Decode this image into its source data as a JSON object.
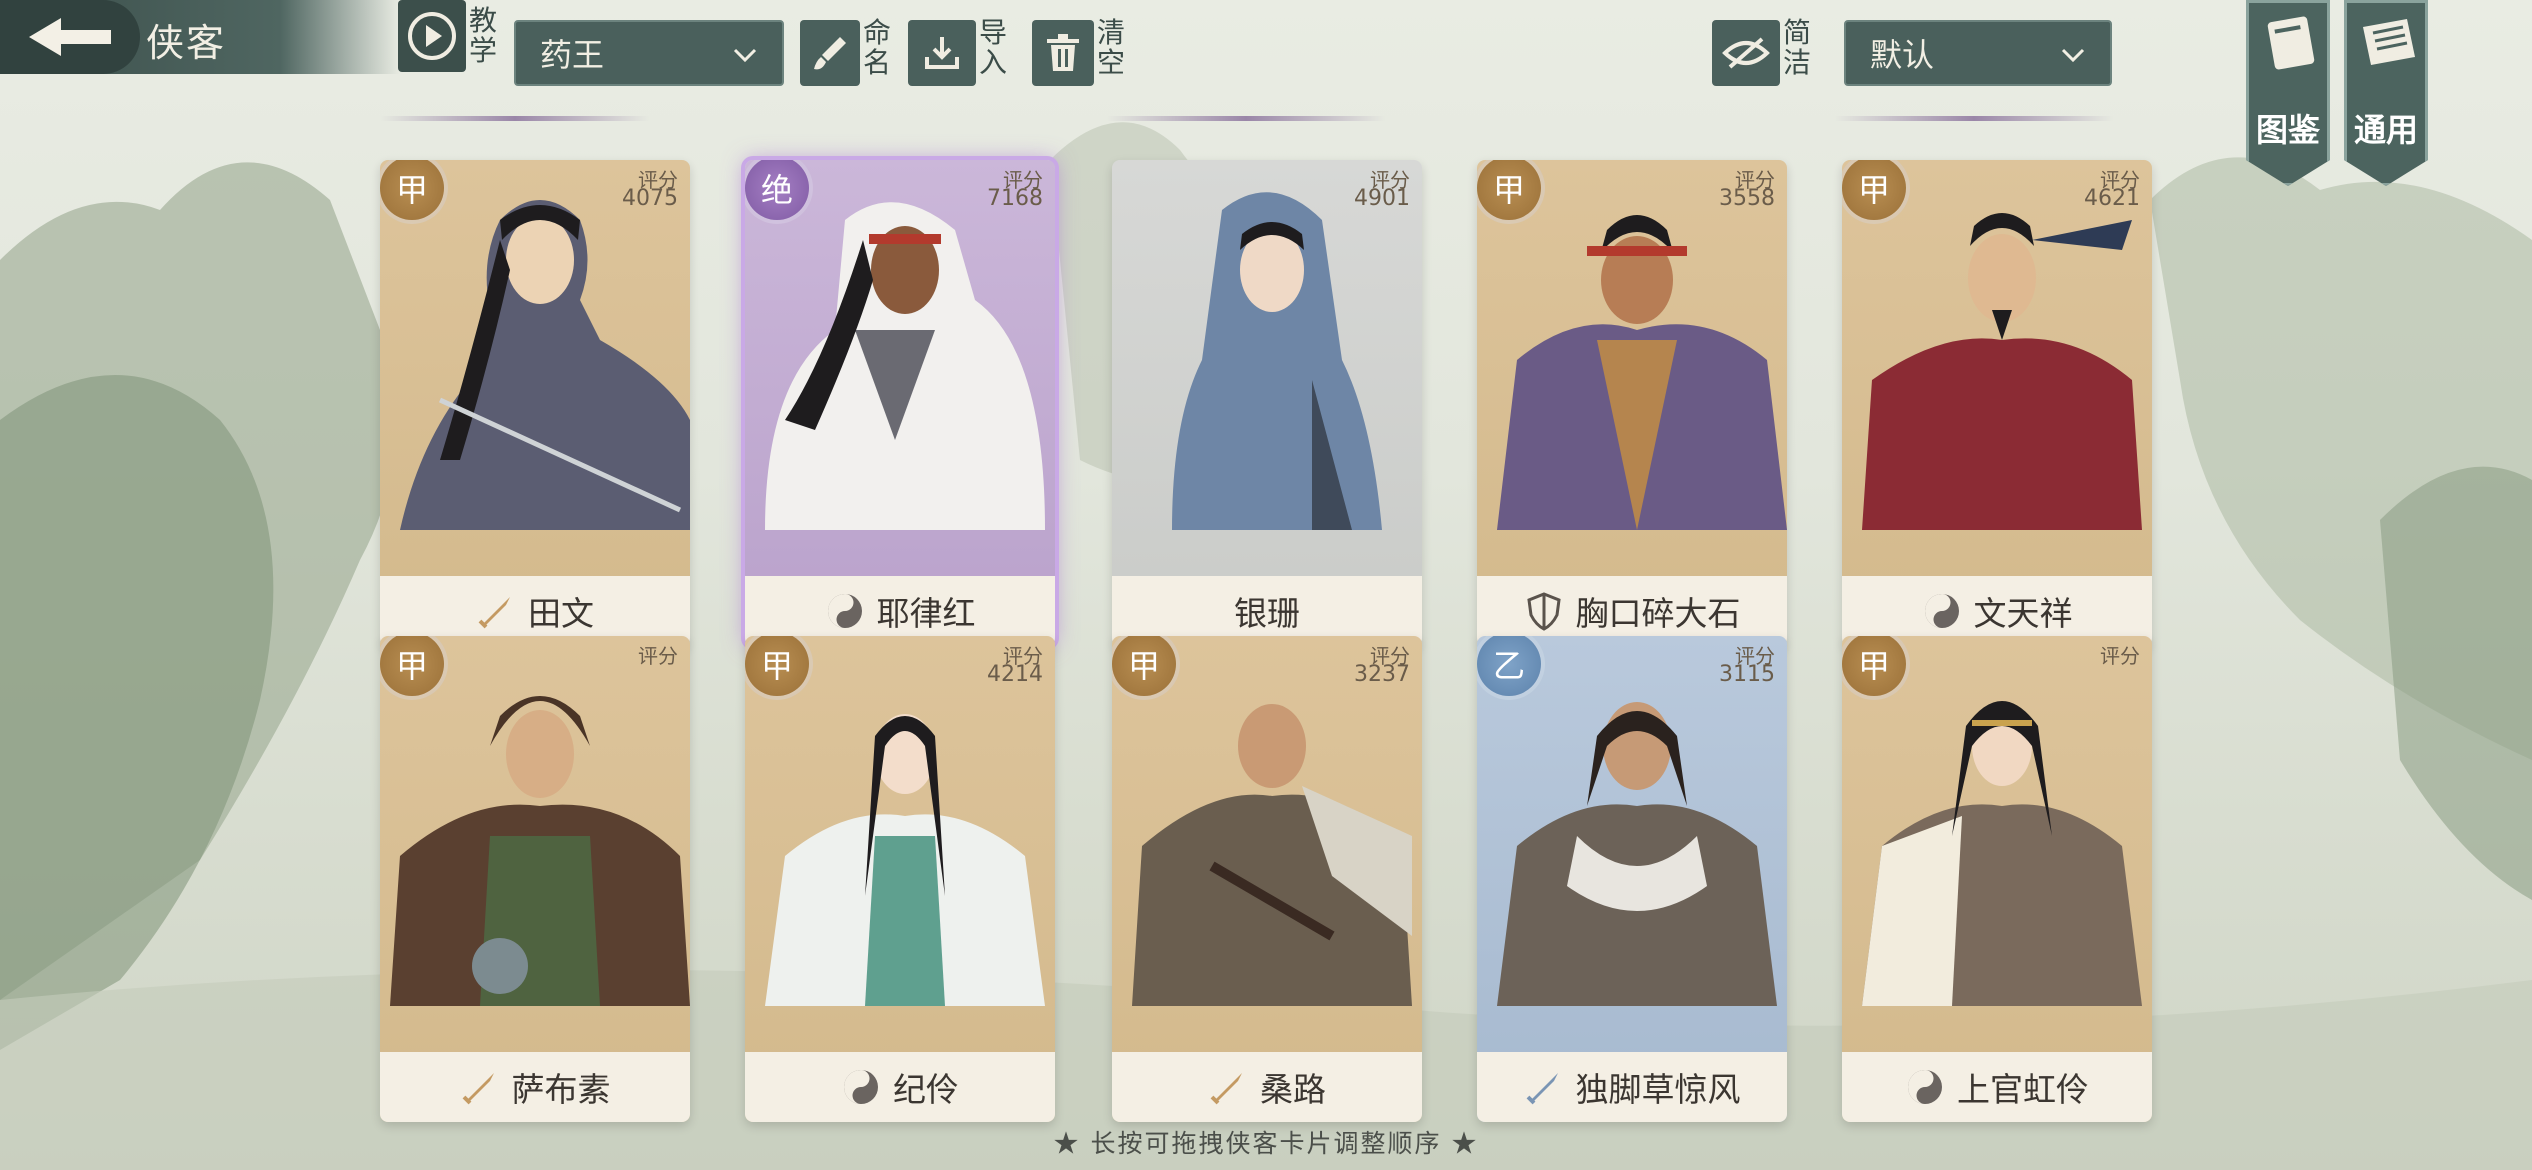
{
  "header": {
    "title": "侠客",
    "tutorial_label": "教学",
    "preset_select": "药王",
    "rename_label": "命名",
    "import_label": "导入",
    "clear_label": "清空",
    "simple_label": "简洁",
    "sort_select": "默认",
    "codex_label": "图鉴",
    "general_label": "通用"
  },
  "cards": [
    {
      "name": "田文",
      "score_label": "评分",
      "score": "4075",
      "rank": "甲",
      "tier": "tan",
      "class_icon": "sword-icon"
    },
    {
      "name": "耶律红",
      "score_label": "评分",
      "score": "7168",
      "rank": "绝",
      "tier": "purple",
      "class_icon": "taichi-icon"
    },
    {
      "name": "银珊",
      "score_label": "评分",
      "score": "4901",
      "rank": "",
      "tier": "silver",
      "class_icon": ""
    },
    {
      "name": "胸口碎大石",
      "score_label": "评分",
      "score": "3558",
      "rank": "甲",
      "tier": "tan",
      "class_icon": "shield-icon"
    },
    {
      "name": "文天祥",
      "score_label": "评分",
      "score": "4621",
      "rank": "甲",
      "tier": "tan",
      "class_icon": "taichi-icon"
    },
    {
      "name": "萨布素",
      "score_label": "评分",
      "score": "",
      "rank": "甲",
      "tier": "tan",
      "class_icon": "sword-icon"
    },
    {
      "name": "纪伶",
      "score_label": "评分",
      "score": "4214",
      "rank": "甲",
      "tier": "tan",
      "class_icon": "taichi-icon"
    },
    {
      "name": "桑路",
      "score_label": "评分",
      "score": "3237",
      "rank": "甲",
      "tier": "tan",
      "class_icon": "sword-icon"
    },
    {
      "name": "独脚草惊风",
      "score_label": "评分",
      "score": "3115",
      "rank": "乙",
      "tier": "blue",
      "class_icon": "sword-icon"
    },
    {
      "name": "上官虹伶",
      "score_label": "评分",
      "score": "",
      "rank": "甲",
      "tier": "tan",
      "class_icon": "taichi-icon"
    }
  ],
  "footer": {
    "hint": "★ 长按可拖拽侠客卡片调整顺序 ★"
  },
  "colors": {
    "toolbar_bg": "#4a605c",
    "tan_card": "#ddc49b",
    "purple_card": "#b9a1cb",
    "blue_card": "#a6b9cf",
    "silver_card": "#c9cbc8"
  }
}
